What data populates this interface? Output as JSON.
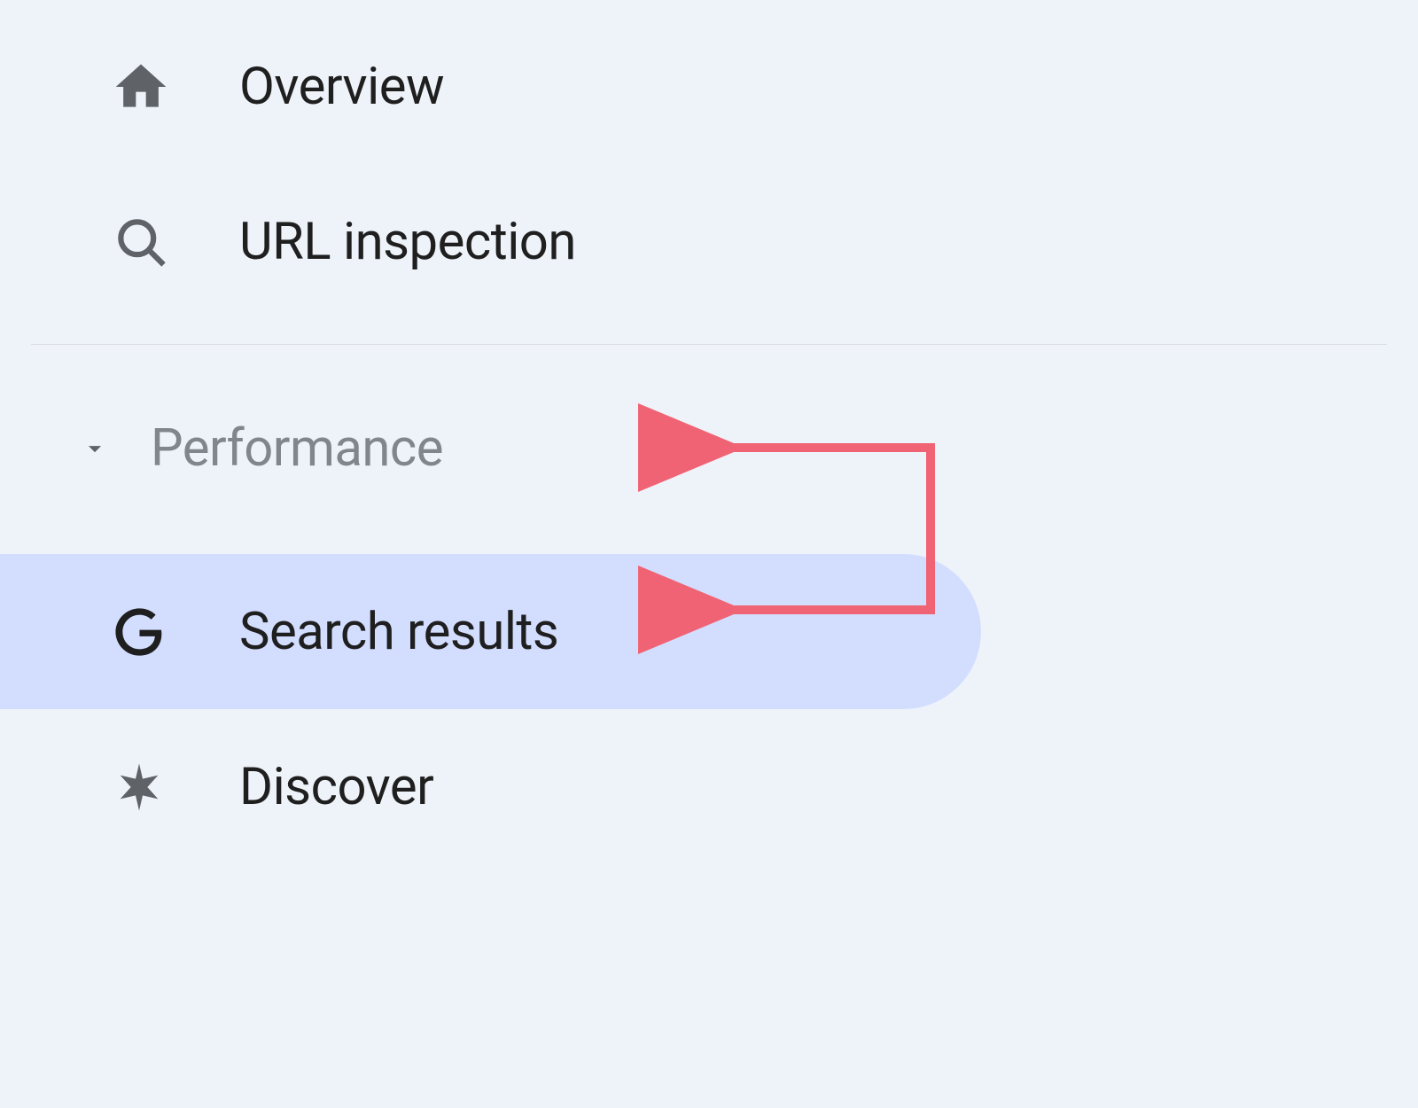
{
  "sidebar": {
    "items": [
      {
        "label": "Overview",
        "icon": "home-icon"
      },
      {
        "label": "URL inspection",
        "icon": "search-icon"
      }
    ],
    "section": {
      "label": "Performance",
      "items": [
        {
          "label": "Search results",
          "icon": "google-g-icon",
          "selected": true
        },
        {
          "label": "Discover",
          "icon": "asterisk-icon",
          "selected": false
        }
      ]
    }
  },
  "annotation": {
    "color": "#f06374"
  }
}
